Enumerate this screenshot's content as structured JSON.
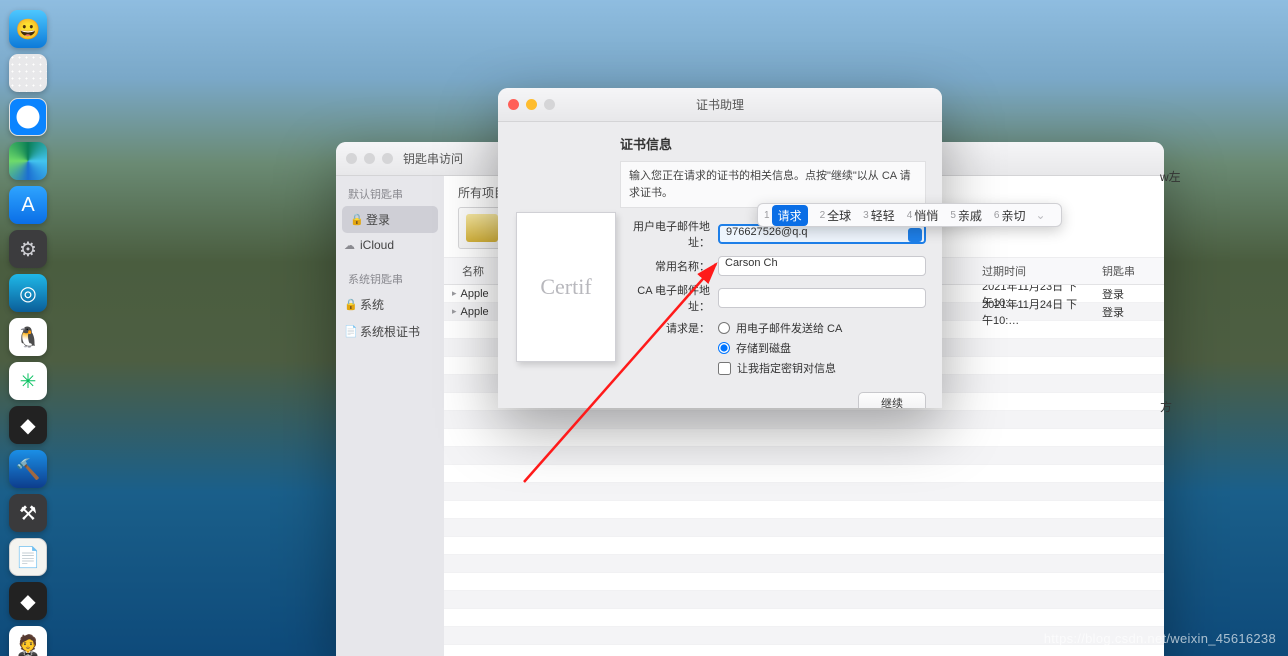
{
  "dock": {
    "items": [
      {
        "name": "finder",
        "cls": "finder",
        "glyph": "😀"
      },
      {
        "name": "launchpad",
        "cls": "launchpad",
        "glyph": ""
      },
      {
        "name": "safari",
        "cls": "safari",
        "glyph": ""
      },
      {
        "name": "edge",
        "cls": "edge",
        "glyph": ""
      },
      {
        "name": "appstore",
        "cls": "appstore",
        "glyph": "A"
      },
      {
        "name": "settings",
        "cls": "settings",
        "glyph": "⚙"
      },
      {
        "name": "quicktime",
        "cls": "qtime",
        "glyph": "◎"
      },
      {
        "name": "qq",
        "cls": "qq",
        "glyph": "🐧"
      },
      {
        "name": "wechat",
        "cls": "wechat",
        "glyph": "✳"
      },
      {
        "name": "unity",
        "cls": "unity",
        "glyph": "◆"
      },
      {
        "name": "xcode",
        "cls": "xcode",
        "glyph": "🔨"
      },
      {
        "name": "tool",
        "cls": "tool",
        "glyph": "⚒"
      },
      {
        "name": "notes",
        "cls": "notes",
        "glyph": "📄"
      },
      {
        "name": "unity2",
        "cls": "unity",
        "glyph": "◆"
      },
      {
        "name": "butler",
        "cls": "butler",
        "glyph": "🤵"
      }
    ]
  },
  "keychain": {
    "title": "钥匙串访问",
    "side_default_hdr": "默认钥匙串",
    "side_login": "登录",
    "side_icloud": "iCloud",
    "side_system_hdr": "系统钥匙串",
    "side_system": "系统",
    "side_sysroot": "系统根证书",
    "top_allitems": "所有项目",
    "col_name": "名称",
    "col_date": "过期时间",
    "col_chain": "钥匙串",
    "rows": [
      {
        "name": "Apple",
        "date": "2021年11月23日 下午10:…",
        "chain": "登录"
      },
      {
        "name": "Apple",
        "date": "2021年11月24日 下午10:…",
        "chain": "登录"
      }
    ],
    "extra_right": "w左",
    "extra_right2": "方"
  },
  "assistant": {
    "window_title": "证书助理",
    "header": "证书信息",
    "desc": "输入您正在请求的证书的相关信息。点按\"继续\"以从 CA 请求证书。",
    "lbl_email": "用户电子邮件地址：",
    "val_email": "976627526@q.q",
    "lbl_common": "常用名称：",
    "val_common": "Carson Ch",
    "lbl_caemail": "CA 电子邮件地址：",
    "val_caemail": "",
    "lbl_request": "请求是：",
    "opt_email": "用电子邮件发送给 CA",
    "opt_disk": "存储到磁盘",
    "chk_keyinfo": "让我指定密钥对信息",
    "btn_continue": "继续"
  },
  "ime": {
    "items": [
      {
        "n": "1",
        "w": "请求"
      },
      {
        "n": "2",
        "w": "全球"
      },
      {
        "n": "3",
        "w": "轻轻"
      },
      {
        "n": "4",
        "w": "悄悄"
      },
      {
        "n": "5",
        "w": "亲戚"
      },
      {
        "n": "6",
        "w": "亲切"
      }
    ]
  },
  "watermark": "https://blog.csdn.net/weixin_45616238"
}
